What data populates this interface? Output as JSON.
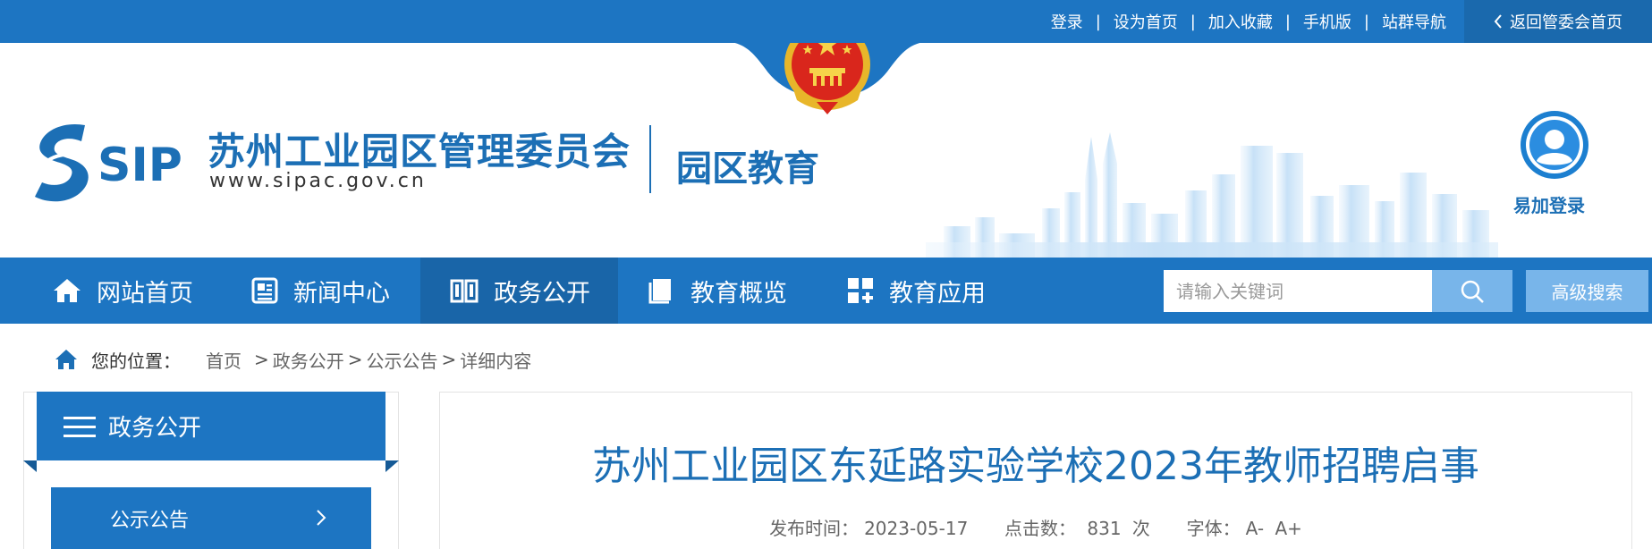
{
  "topbar": {
    "links": [
      "登录",
      "设为首页",
      "加入收藏",
      "手机版",
      "站群导航"
    ],
    "separator": "|",
    "back_label": "返回管委会首页"
  },
  "header": {
    "logo_text": "SIP",
    "org_title": "苏州工业园区管理委员会",
    "org_url": "www.sipac.gov.cn",
    "site_name": "园区教育",
    "login_label": "易加登录"
  },
  "nav": {
    "items": [
      {
        "label": "网站首页",
        "icon": "home-icon"
      },
      {
        "label": "新闻中心",
        "icon": "news-icon"
      },
      {
        "label": "政务公开",
        "icon": "book-icon",
        "active": true
      },
      {
        "label": "教育概览",
        "icon": "document-icon"
      },
      {
        "label": "教育应用",
        "icon": "apps-grid-icon"
      }
    ],
    "search_placeholder": "请输入关键词",
    "advanced_search_label": "高级搜索"
  },
  "breadcrumb": {
    "label": "您的位置：",
    "items": [
      "首页",
      "政务公开",
      "公示公告",
      "详细内容"
    ],
    "separator": ">"
  },
  "sidebar": {
    "title": "政务公开",
    "items": [
      {
        "label": "公示公告"
      }
    ]
  },
  "article": {
    "title": "苏州工业园区东延路实验学校2023年教师招聘启事",
    "publish_label": "发布时间：",
    "publish_date": "2023-05-17",
    "clicks_label": "点击数：",
    "clicks_value": "831",
    "clicks_unit": "次",
    "font_label": "字体：",
    "font_smaller": "A-",
    "font_larger": "A+"
  },
  "colors": {
    "primary": "#1d75c2",
    "primary_dark": "#1965a8",
    "light_button": "#78b5ea",
    "title_blue": "#1c6fb5"
  }
}
